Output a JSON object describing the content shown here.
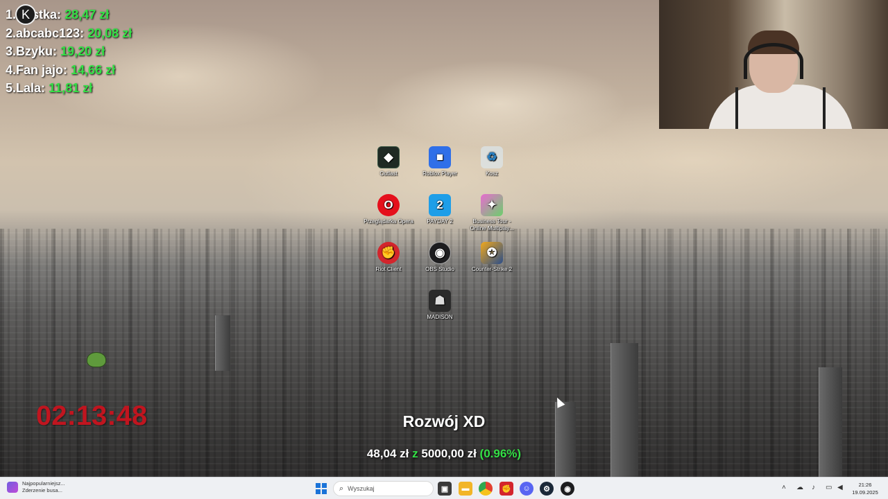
{
  "leaderboard": {
    "rows": [
      {
        "name": "1.Nastka:",
        "amount": "28,47 zł"
      },
      {
        "name": "2.abcabc123:",
        "amount": "20,08 zł"
      },
      {
        "name": "3.Bzyku:",
        "amount": "19,20 zł"
      },
      {
        "name": "4.Fan jajo:",
        "amount": "14,66 zł"
      },
      {
        "name": "5.Lala:",
        "amount": "11,81 zł"
      }
    ],
    "logo_glyph": "K"
  },
  "desktop_icons": [
    {
      "label": "Outlast",
      "icon": "outlast-icon",
      "glyph": "◆"
    },
    {
      "label": "Roblox Player",
      "icon": "roblox-icon",
      "glyph": "■"
    },
    {
      "label": "Kosz",
      "icon": "recycle-bin-icon",
      "glyph": "♻"
    },
    {
      "label": "Przeglądarka Opera",
      "icon": "opera-icon",
      "glyph": "O"
    },
    {
      "label": "PAYDAY 2",
      "icon": "payday2-icon",
      "glyph": "2"
    },
    {
      "label": "Business Tour - Online Multiplay...",
      "icon": "business-tour-icon",
      "glyph": "✦"
    },
    {
      "label": "Riot Client",
      "icon": "riot-client-icon",
      "glyph": "✊"
    },
    {
      "label": "OBS Studio",
      "icon": "obs-icon",
      "glyph": "◉"
    },
    {
      "label": "Counter-Strike 2",
      "icon": "counter-strike-icon",
      "glyph": "✪"
    },
    {
      "label": "MADISON",
      "icon": "madison-icon",
      "glyph": "☗"
    }
  ],
  "timer": "02:13:48",
  "goal": {
    "title": "Rozwój XD",
    "current": "48,04 zł",
    "of_word": "z",
    "target": "5000,00 zł",
    "percent": "(0.96%)",
    "progress_fraction": 0.0096
  },
  "taskbar": {
    "news_line1": "Najpopularniejsz...",
    "news_line2": "Zderzenie busa...",
    "search_placeholder": "Wyszukaj",
    "apps": [
      "task-view-icon",
      "file-explorer-icon",
      "chrome-icon",
      "riot-icon",
      "discord-icon",
      "steam-icon",
      "obs-icon"
    ],
    "clock_time": "21:26",
    "clock_date": "19.09.2025"
  },
  "colors": {
    "amount_green": "#34e046",
    "timer_red": "#c0151f",
    "start_blue": "#1a73d8"
  }
}
